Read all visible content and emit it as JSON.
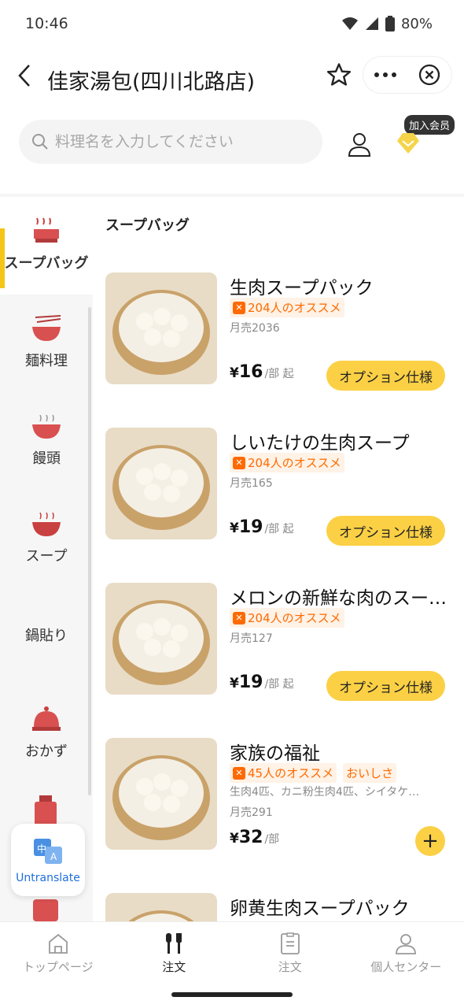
{
  "status_bar": {
    "time": "10:46",
    "battery": "80%"
  },
  "header": {
    "title": "佳家湯包(四川北路店)"
  },
  "search": {
    "placeholder": "料理名を入力してください"
  },
  "member": {
    "badge": "加入会员"
  },
  "sidebar": {
    "items": [
      {
        "label": "スープバッグ",
        "icon": "dumpling-steamer-icon",
        "active": true
      },
      {
        "label": "麺料理",
        "icon": "noodle-bowl-icon"
      },
      {
        "label": "饅頭",
        "icon": "bowl-icon"
      },
      {
        "label": "スープ",
        "icon": "soup-bowl-icon"
      },
      {
        "label": "鍋貼り",
        "icon": ""
      },
      {
        "label": "おかず",
        "icon": "covered-dish-icon"
      }
    ]
  },
  "translate_button": {
    "label": "Untranslate"
  },
  "section_title": "スープバッグ",
  "products": [
    {
      "name": "生肉スープパック",
      "tags": [
        "204人のオススメ"
      ],
      "desc": "",
      "sales": "月売2036",
      "price": "16",
      "unit": "/部 起",
      "action": "オプション仕様"
    },
    {
      "name": "しいたけの生肉スープ",
      "tags": [
        "204人のオススメ"
      ],
      "desc": "",
      "sales": "月売165",
      "price": "19",
      "unit": "/部 起",
      "action": "オプション仕様"
    },
    {
      "name": "メロンの新鮮な肉のスー…",
      "tags": [
        "204人のオススメ"
      ],
      "desc": "",
      "sales": "月売127",
      "price": "19",
      "unit": "/部 起",
      "action": "オプション仕様"
    },
    {
      "name": "家族の福祉",
      "tags": [
        "45人のオススメ",
        "おいしさ"
      ],
      "desc": "生肉4匹、カニ粉生肉4匹、シイタケ…",
      "sales": "月売291",
      "price": "32",
      "unit": "/部",
      "action": "+"
    },
    {
      "name": "卵黄生肉スープパック",
      "tags": [],
      "desc": "",
      "sales": "",
      "price": "",
      "unit": "",
      "action": ""
    }
  ],
  "bottom_nav": [
    {
      "label": "トップページ",
      "icon": "home-icon"
    },
    {
      "label": "注文",
      "icon": "fork-knife-icon",
      "active": true
    },
    {
      "label": "注文",
      "icon": "order-list-icon"
    },
    {
      "label": "個人センター",
      "icon": "person-icon"
    }
  ],
  "currency": "¥",
  "colors": {
    "accent": "#fbd045",
    "tag": "#ff6a00",
    "active_bar": "#f5c518"
  }
}
